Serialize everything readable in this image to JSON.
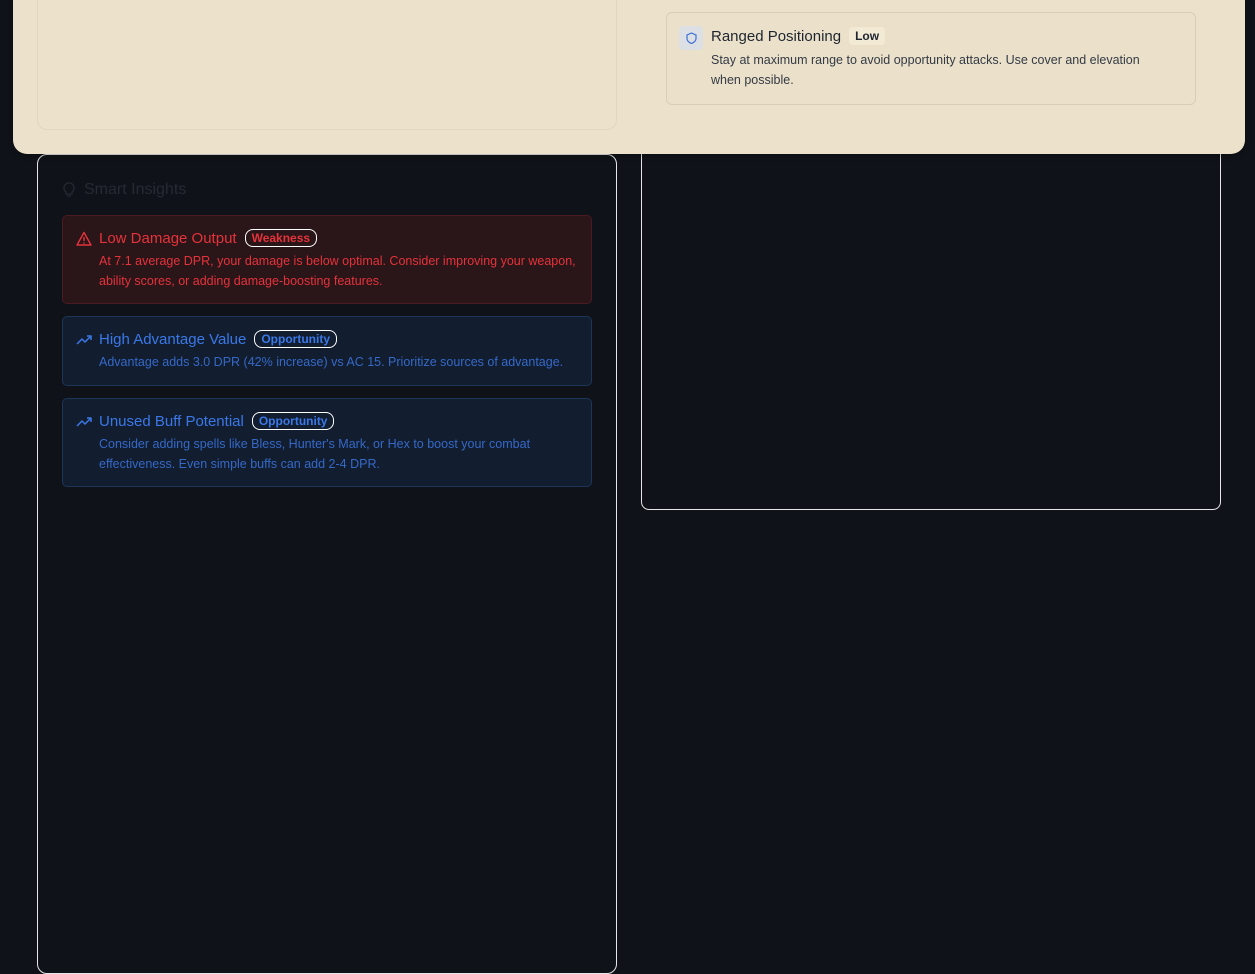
{
  "insights": {
    "header": "Smart Insights",
    "header_icon": "lightbulb-icon",
    "items": [
      {
        "type": "weakness",
        "icon": "warning-triangle-icon",
        "title": "Low Damage Output",
        "badge": "Weakness",
        "description": "At 7.1 average DPR, your damage is below optimal. Consider improving your weapon, ability scores, or adding damage-boosting features.",
        "color": "#e5333b"
      },
      {
        "type": "opportunity",
        "icon": "trending-up-icon",
        "title": "High Advantage Value",
        "badge": "Opportunity",
        "description": "Advantage adds 3.0 DPR (42% increase) vs AC 15. Prioritize sources of advantage.",
        "color": "#3a78e8"
      },
      {
        "type": "opportunity",
        "icon": "trending-up-icon",
        "title": "Unused Buff Potential",
        "badge": "Opportunity",
        "description": "Consider adding spells like Bless, Hunter's Mark, or Hex to boost your combat effectiveness. Even simple buffs can add 2-4 DPR.",
        "color": "#3a78e8"
      }
    ]
  },
  "tactical_tip": {
    "icon": "shield-icon",
    "title": "Ranged Positioning",
    "priority": "Low",
    "description": "Stay at maximum range to avoid opportunity attacks. Use cover and elevation when possible."
  },
  "colors": {
    "overlay_background": "#ece2cb",
    "page_background": "#0f1218"
  }
}
